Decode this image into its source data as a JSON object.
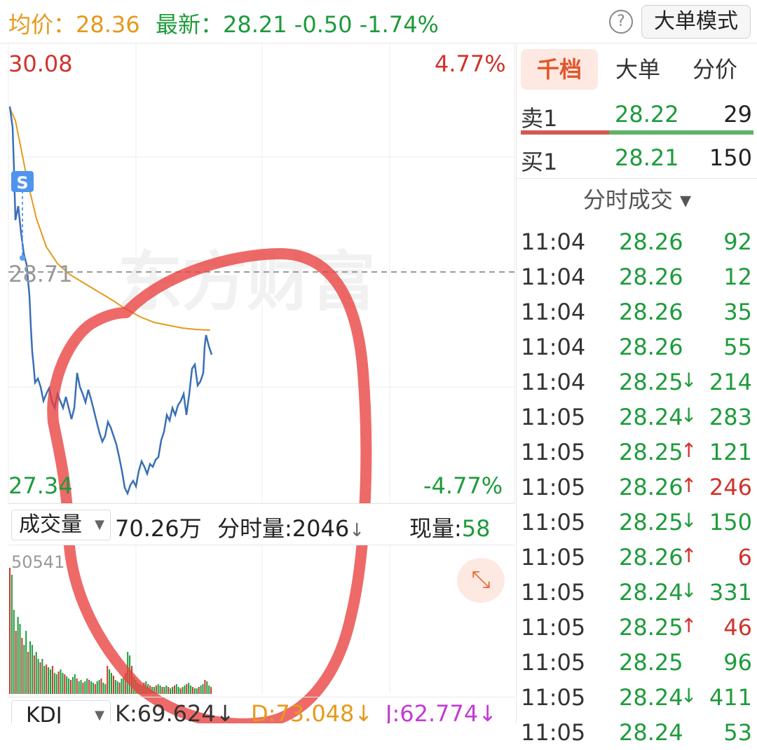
{
  "header": {
    "avg_label": "均价：28.36",
    "latest_label": "最新：28.21  -0.50  -1.74%",
    "help_icon": "?",
    "mode_button": "大单模式"
  },
  "chart": {
    "price_high": "30.08",
    "pct_high": "4.77%",
    "price_ref": "28.71",
    "price_low": "27.34",
    "pct_low": "-4.77%",
    "watermark": "东方财富",
    "signal_badge": "S"
  },
  "volume_bar": {
    "dropdown_label": "成交量",
    "total": "70.26万",
    "minute_volume": "分时量:2046",
    "minute_arrow": "↓",
    "current_label": "现量:",
    "current_value": "58",
    "axis_max": "50541"
  },
  "kdj_bar": {
    "dropdown_label": "KDJ",
    "k": "K:69.624↓",
    "d": "D:73.048↓",
    "j": "J:62.774↓"
  },
  "right_panel": {
    "tabs": [
      "千档",
      "大单",
      "分价"
    ],
    "ask": {
      "label": "卖1",
      "price": "28.22",
      "volume": "29"
    },
    "bid": {
      "label": "买1",
      "price": "28.21",
      "volume": "150"
    },
    "ticks_title": "分时成交 ▾",
    "ticks": [
      {
        "time": "11:04",
        "price": "28.26",
        "arrow": "",
        "volume": "92",
        "color": "#1e9b3b"
      },
      {
        "time": "11:04",
        "price": "28.26",
        "arrow": "",
        "volume": "12",
        "color": "#1e9b3b"
      },
      {
        "time": "11:04",
        "price": "28.26",
        "arrow": "",
        "volume": "35",
        "color": "#1e9b3b"
      },
      {
        "time": "11:04",
        "price": "28.26",
        "arrow": "",
        "volume": "55",
        "color": "#1e9b3b"
      },
      {
        "time": "11:04",
        "price": "28.25",
        "arrow": "↓",
        "volume": "214",
        "color": "#1e9b3b"
      },
      {
        "time": "11:05",
        "price": "28.24",
        "arrow": "↓",
        "volume": "283",
        "color": "#1e9b3b"
      },
      {
        "time": "11:05",
        "price": "28.25",
        "arrow": "↑",
        "volume": "121",
        "color": "#1e9b3b"
      },
      {
        "time": "11:05",
        "price": "28.26",
        "arrow": "↑",
        "volume": "246",
        "color": "#d0342c"
      },
      {
        "time": "11:05",
        "price": "28.25",
        "arrow": "↓",
        "volume": "150",
        "color": "#1e9b3b"
      },
      {
        "time": "11:05",
        "price": "28.26",
        "arrow": "↑",
        "volume": "6",
        "color": "#d0342c"
      },
      {
        "time": "11:05",
        "price": "28.24",
        "arrow": "↓",
        "volume": "331",
        "color": "#1e9b3b"
      },
      {
        "time": "11:05",
        "price": "28.25",
        "arrow": "↑",
        "volume": "46",
        "color": "#d0342c"
      },
      {
        "time": "11:05",
        "price": "28.25",
        "arrow": "",
        "volume": "96",
        "color": "#1e9b3b"
      },
      {
        "time": "11:05",
        "price": "28.24",
        "arrow": "↓",
        "volume": "411",
        "color": "#1e9b3b"
      },
      {
        "time": "11:05",
        "price": "28.24",
        "arrow": "",
        "volume": "53",
        "color": "#1e9b3b"
      }
    ]
  },
  "colors": {
    "up": "#d0342c",
    "down": "#1e9b3b",
    "price_line": "#3a6fb5",
    "avg_line": "#e59a1b",
    "annotation": "#e23c3c"
  }
}
